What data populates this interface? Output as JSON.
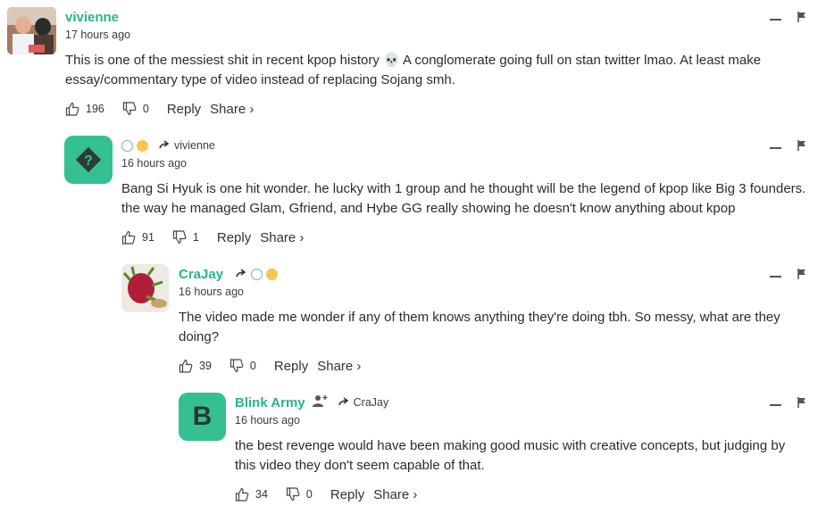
{
  "comments": [
    {
      "username": "vivienne",
      "time": "17 hours ago",
      "text": "This is one of the messiest shit in recent kpop history 💀 A conglomerate going full on stan twitter lmao. At least make essay/commentary type of video instead of replacing Sojang smh.",
      "likes": "196",
      "dislikes": "0",
      "reply_label": "Reply",
      "share_label": "Share ›"
    },
    {
      "username": "",
      "reply_to": "vivienne",
      "time": "16 hours ago",
      "text": "Bang Si Hyuk is one hit wonder. he lucky with 1 group and he thought will be the legend of kpop like Big 3 founders. the way he managed Glam, Gfriend, and Hybe GG really showing he doesn't know anything about kpop",
      "likes": "91",
      "dislikes": "1",
      "reply_label": "Reply",
      "share_label": "Share ›"
    },
    {
      "username": "CraJay",
      "time": "16 hours ago",
      "text": "The video made me wonder if any of them knows anything they're doing tbh. So messy, what are they doing?",
      "likes": "39",
      "dislikes": "0",
      "reply_label": "Reply",
      "share_label": "Share ›"
    },
    {
      "username": "Blink Army",
      "avatar_letter": "B",
      "reply_to": "CraJay",
      "time": "16 hours ago",
      "text": "the best revenge would have been making good music with creative concepts, but judging by this video they don't seem capable of that.",
      "likes": "34",
      "dislikes": "0",
      "reply_label": "Reply",
      "share_label": "Share ›"
    }
  ],
  "colors": {
    "accent": "#2ab38a",
    "avatar_green": "#35c08f"
  },
  "icons": [
    "thumbs-up-icon",
    "thumbs-down-icon",
    "minimize-icon",
    "flag-icon",
    "reply-arrow-icon",
    "globe-badge-icon",
    "sun-badge-icon",
    "add-user-icon"
  ]
}
